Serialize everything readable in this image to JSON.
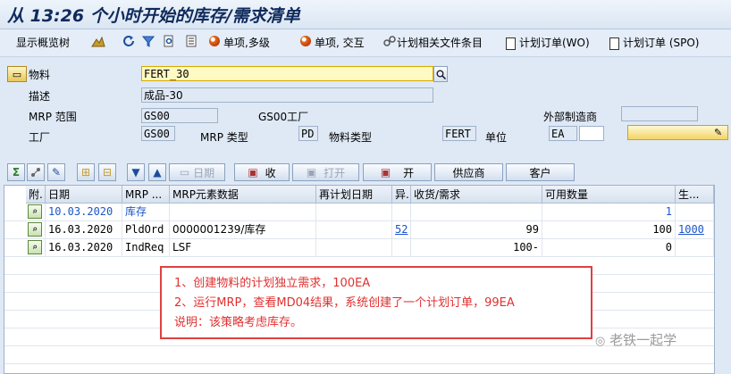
{
  "title": "从 13:26 个小时开始的库存/需求清单",
  "toolbar": {
    "show_tree": "显示概览树",
    "single_multi": "单项,多级",
    "single_interactive": "单项, 交互",
    "plan_files": "计划相关文件条目",
    "plan_order_wo": "计划订单(WO)",
    "plan_order_spo": "计划订单 (SPO)"
  },
  "form": {
    "material_label": "物料",
    "material_value": "FERT_30",
    "description_label": "描述",
    "description_value": "成品-30",
    "mrp_area_label": "MRP 范围",
    "mrp_area_value": "GS00",
    "mrp_area_text": "GS00工厂",
    "external_mfr_label": "外部制造商",
    "plant_label": "工厂",
    "plant_value": "GS00",
    "mrp_type_label": "MRP 类型",
    "mrp_type_value": "PD",
    "material_type_label": "物料类型",
    "material_type_value": "FERT",
    "unit_label": "单位",
    "unit_value": "EA"
  },
  "buttons": {
    "date": "日期",
    "receive": "收",
    "open": "打开",
    "open2": "开",
    "vendor": "供应商",
    "customer": "客户"
  },
  "table": {
    "headers": [
      "附.",
      "日期",
      "MRP ...",
      "MRP元素数据",
      "再计划日期",
      "异.",
      "收货/需求",
      "可用数量",
      "生..."
    ],
    "rows": [
      {
        "date": "10.03.2020",
        "mrp": "库存",
        "data": "",
        "replan": "",
        "exc": "",
        "rec": "",
        "avail": "1",
        "prod": ""
      },
      {
        "date": "16.03.2020",
        "mrp": "PldOrd",
        "data": "0000001239/库存",
        "replan": "",
        "exc": "52",
        "rec": "99",
        "avail": "100",
        "prod": "1000"
      },
      {
        "date": "16.03.2020",
        "mrp": "IndReq",
        "data": "LSF",
        "replan": "",
        "exc": "",
        "rec": "100-",
        "avail": "0",
        "prod": ""
      }
    ]
  },
  "annotation": {
    "line1": "1、创建物料的计划独立需求，100EA",
    "line2": "2、运行MRP，查看MD04结果，系统创建了一个计划订单，99EA",
    "line3": "说明：该策略考虑库存。"
  },
  "watermark": "老铁一起学"
}
